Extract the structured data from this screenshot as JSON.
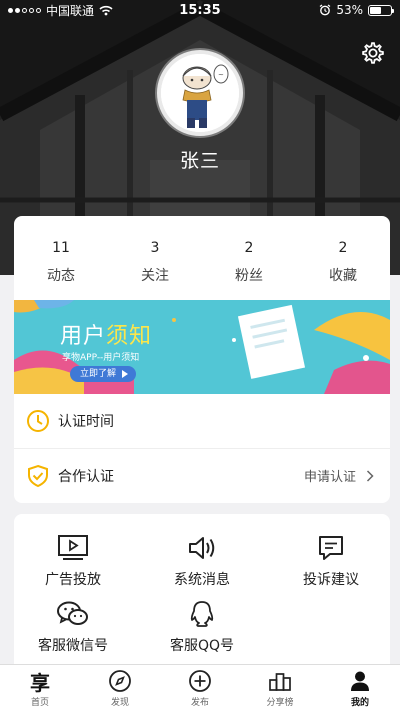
{
  "status_bar": {
    "carrier": "中国联通",
    "time": "15:35",
    "battery": "53%",
    "battery_level": 0.53
  },
  "profile": {
    "name": "张三"
  },
  "stats": [
    {
      "count": "11",
      "label": "动态"
    },
    {
      "count": "3",
      "label": "关注"
    },
    {
      "count": "2",
      "label": "粉丝"
    },
    {
      "count": "2",
      "label": "收藏"
    }
  ],
  "banner": {
    "title_part1": "用户",
    "title_part2": "须知",
    "subtitle": "享物APP--用户须知",
    "button": "立即了解"
  },
  "rows": {
    "cert_time": "认证时间",
    "coop_cert": "合作认证",
    "apply_cert": "申请认证"
  },
  "services": [
    {
      "label": "广告投放",
      "icon": "tv-play-icon"
    },
    {
      "label": "系统消息",
      "icon": "speaker-icon"
    },
    {
      "label": "投诉建议",
      "icon": "message-icon"
    },
    {
      "label": "客服微信号",
      "icon": "wechat-icon"
    },
    {
      "label": "客服QQ号",
      "icon": "qq-icon"
    }
  ],
  "tabs": [
    {
      "label": "首页",
      "icon": "xiang-logo-icon",
      "glyph": "享"
    },
    {
      "label": "发现",
      "icon": "compass-icon"
    },
    {
      "label": "发布",
      "icon": "plus-circle-icon"
    },
    {
      "label": "分享榜",
      "icon": "podium-icon"
    },
    {
      "label": "我的",
      "icon": "person-icon",
      "active": true
    }
  ],
  "colors": {
    "accent_yellow": "#f5b400",
    "banner_bg": "#52c6d5",
    "banner_button": "#3f79d6"
  }
}
